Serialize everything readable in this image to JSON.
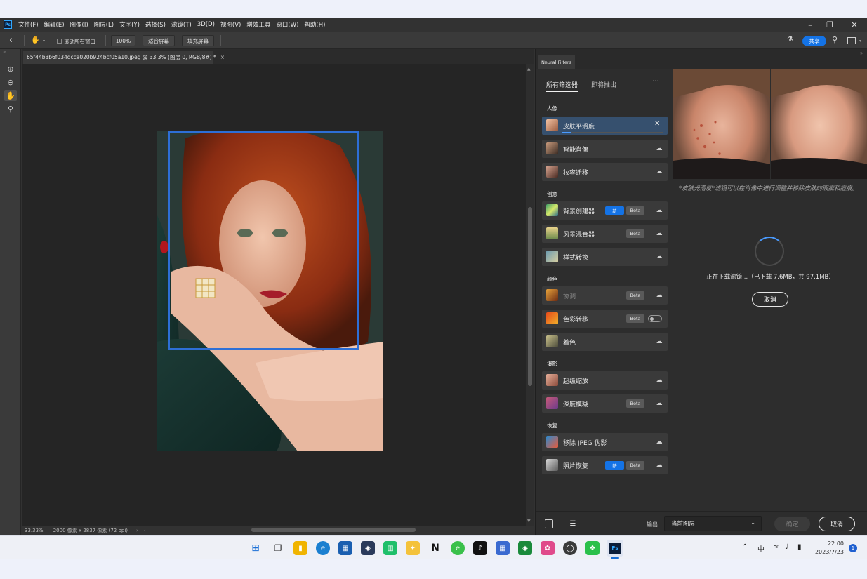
{
  "menubar": {
    "logo": "Ps",
    "items": [
      "文件(F)",
      "编辑(E)",
      "图像(I)",
      "图层(L)",
      "文字(Y)",
      "选择(S)",
      "滤镜(T)",
      "3D(D)",
      "视图(V)",
      "增效工具",
      "窗口(W)",
      "帮助(H)"
    ]
  },
  "options": {
    "scroll_all_windows": "滚动所有窗口",
    "zoom_100": "100%",
    "fit_screen": "适合屏幕",
    "fill_screen": "填充屏幕",
    "share": "共享"
  },
  "document": {
    "tab_title": "65f44b3b6f034dcca020b924bcf05a10.jpeg @ 33.3% (图层 0, RGB/8#) *",
    "zoom": "33.33%",
    "dimensions": "2000 像素 x 2837 像素 (72 ppi)"
  },
  "panel": {
    "tab": "Neural Filters",
    "seg_all": "所有筛选器",
    "seg_coming": "即将推出",
    "more": "···",
    "categories": {
      "portrait": "人像",
      "creative": "创意",
      "color": "颜色",
      "photo": "摄影",
      "restore": "恢复"
    },
    "filters": {
      "skin": "皮肤平滑度",
      "smart_portrait": "智能肖像",
      "makeup": "妆容迁移",
      "bg_creator": "背景创建器",
      "landscape": "风景混合器",
      "style": "样式转换",
      "harmonize": "协调",
      "color_transfer": "色彩转移",
      "colorize": "着色",
      "super_zoom": "超级缩放",
      "depth_blur": "深度模糊",
      "jpeg": "移除 JPEG 伪影",
      "photo_restore": "照片恢复"
    },
    "badge_new": "新",
    "badge_beta": "Beta",
    "skin_progress": 0.08,
    "description": "*皮肤光滑度*滤镜可以在肖像中进行调整并移除皮肤的瑕疵和痘痕。",
    "download_text": "正在下载滤镜...（已下载 7.6MB，共 97.1MB）",
    "cancel_download": "取消",
    "output_label": "输出",
    "output_value": "当前图层",
    "ok": "确定",
    "cancel": "取消"
  },
  "taskbar": {
    "ime": "中",
    "time": "22:00",
    "date": "2023/7/23",
    "notifications": "1"
  },
  "colors": {
    "accent": "#1473e6",
    "selection": "#36506e",
    "crop": "#2d6fd6"
  }
}
